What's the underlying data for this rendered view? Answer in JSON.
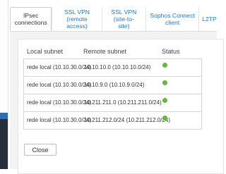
{
  "tabs": [
    {
      "label": "IPsec connections",
      "active": true
    },
    {
      "label": "SSL VPN (remote\naccess)",
      "active": false
    },
    {
      "label": "SSL VPN (site-to-\nsite)",
      "active": false
    },
    {
      "label": "Sophos Connect\nclient",
      "active": false
    },
    {
      "label": "L2TP",
      "active": false
    }
  ],
  "table": {
    "headers": {
      "local": "Local subnet",
      "remote": "Remote subnet",
      "status": "Status"
    },
    "rows": [
      {
        "local": "rede local (10.10.30.0/24)",
        "remote": "10.10.10.0 (10.10.10.0/24)",
        "status": "connected"
      },
      {
        "local": "rede local (10.10.30.0/24)",
        "remote": "10.10.9.0 (10.10.9.0/24)",
        "status": "connected"
      },
      {
        "local": "rede local (10.10.30.0/24)",
        "remote": "10.211.211.0 (10.211.211.0/24)",
        "status": "connected"
      },
      {
        "local": "rede local (10.10.30.0/24)",
        "remote": "10.211.212.0/24 (10.211.212.0/24)",
        "status": "connected"
      }
    ]
  },
  "actions": {
    "close_label": "Close"
  },
  "colors": {
    "status_ok": "#66b83a",
    "link": "#1f78c9",
    "sidebar_accent": "#2f6fb1",
    "sidebar_dark": "#26303c"
  }
}
